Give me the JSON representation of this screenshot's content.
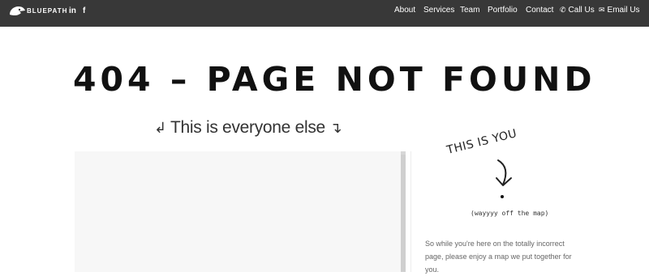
{
  "header": {
    "brand": "BLUEPATH",
    "social": {
      "linkedin": "in",
      "facebook": "f"
    },
    "nav": {
      "about": "About",
      "services": "Services",
      "team": "Team",
      "portfolio": "Portfolio",
      "contact": "Contact",
      "call": "Call Us",
      "email": "Email Us"
    },
    "icons": {
      "phone": "phone-icon",
      "envelope": "envelope-icon"
    }
  },
  "main": {
    "headline": "404 – PAGE NOT FOUND",
    "everyone_label": "This is everyone else",
    "map_region": "map"
  },
  "aside": {
    "this_is_you": "THIS IS YOU",
    "off_map_note": "(wayyyy off the map)",
    "message": "So while you're here on the totally incorrect page, please enjoy a map we put together for you."
  }
}
